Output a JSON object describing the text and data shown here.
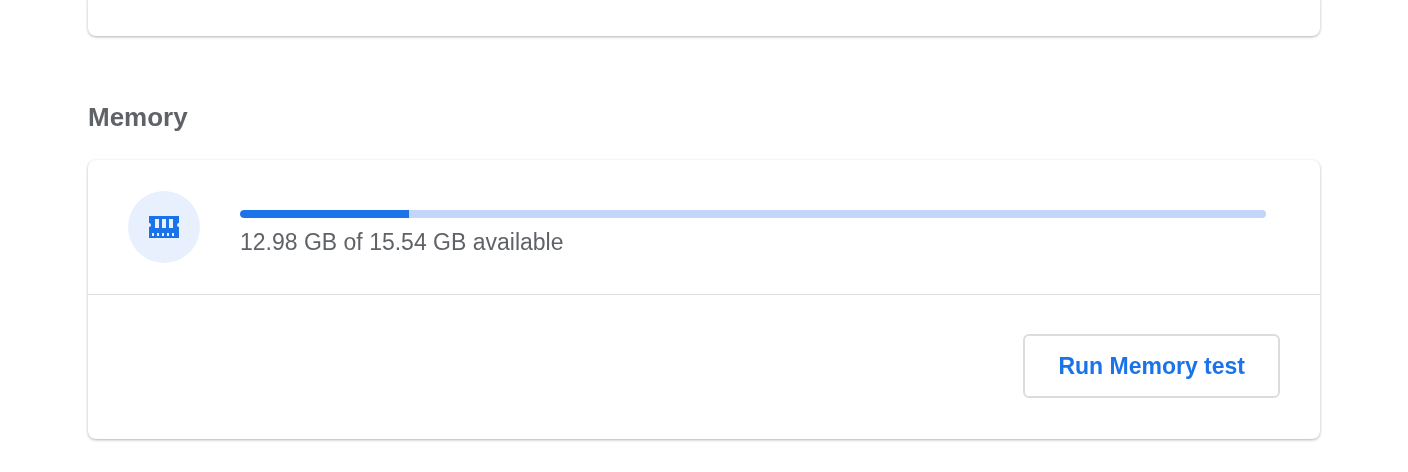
{
  "section": {
    "title": "Memory"
  },
  "memory": {
    "level": 0.165,
    "reading": "12.98 GB of 15.54 GB available"
  },
  "button": {
    "label": "Run Memory test"
  }
}
